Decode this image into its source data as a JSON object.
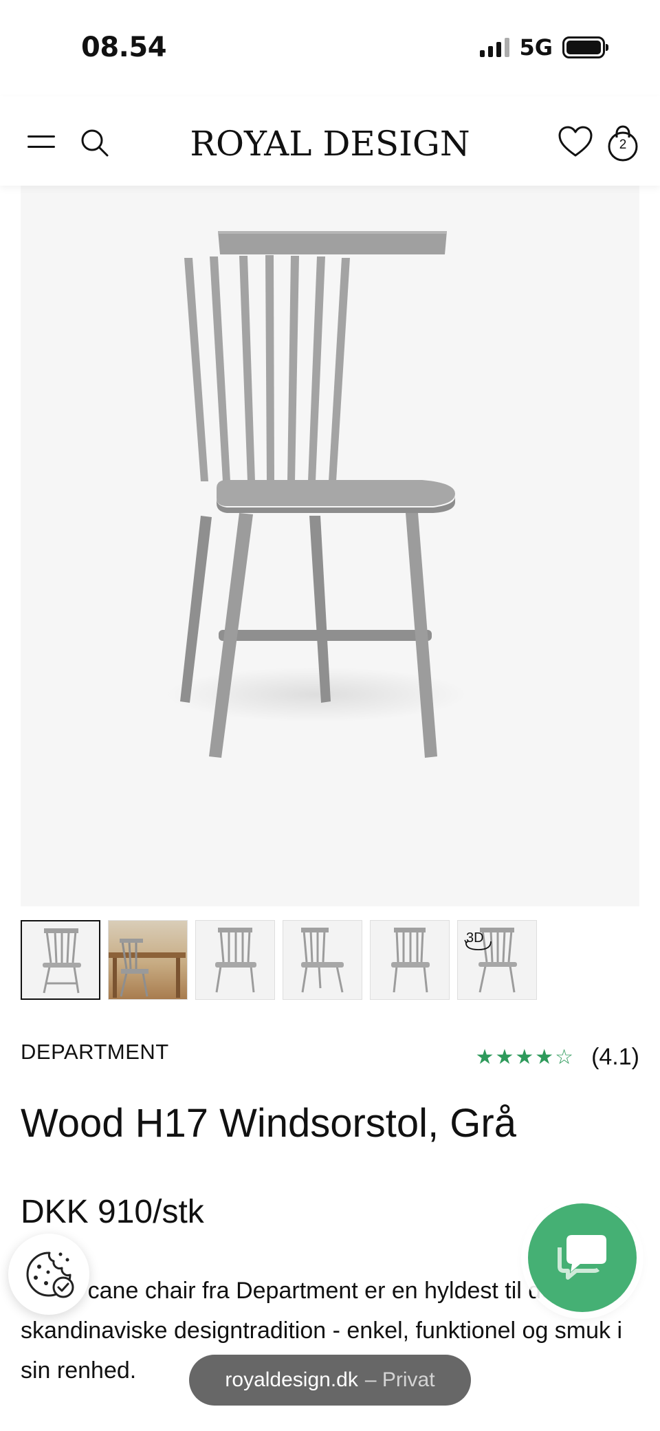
{
  "status_bar": {
    "time": "08.54",
    "network": "5G"
  },
  "header": {
    "logo": "ROYAL DESIGN",
    "cart_count": "2",
    "icons": [
      "menu-icon",
      "search-icon",
      "heart-icon",
      "shopping-bag-icon"
    ]
  },
  "gallery": {
    "thumbnails": [
      {
        "label": ""
      },
      {
        "label": ""
      },
      {
        "label": ""
      },
      {
        "label": ""
      },
      {
        "label": ""
      },
      {
        "label": "3D"
      }
    ]
  },
  "product": {
    "brand": "DEPARTMENT",
    "rating_value": "(4.1)",
    "rating_stars": "★★★★☆",
    "rating": 4.1,
    "title": "Wood H17 Windsorstol, Grå",
    "price": "DKK 910/stk",
    "description": "Wood cane chair fra Department er en hyldest til den skandinaviske designtradition - enkel, funktionel og smuk i sin renhed."
  },
  "browser": {
    "url": "royaldesign.dk",
    "mode": "– Privat"
  },
  "colors": {
    "accent": "#45b074",
    "stars": "#2e9a5b",
    "chair": "#9a9a9a"
  }
}
